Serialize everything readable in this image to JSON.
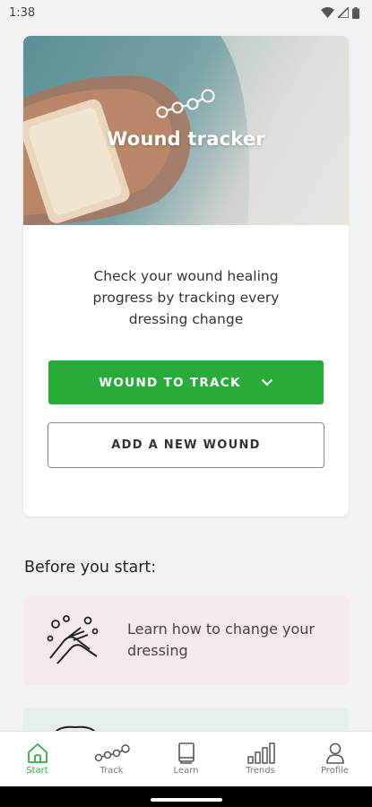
{
  "status_bar": {
    "time": "1:38"
  },
  "hero": {
    "title": "Wound tracker"
  },
  "card": {
    "description": "Check your wound healing progress by tracking every dressing change",
    "primary_button": "WOUND TO TRACK",
    "secondary_button": "ADD A NEW WOUND"
  },
  "before_section": {
    "title": "Before you start:",
    "tips": [
      {
        "label": "Learn how to change your dressing"
      }
    ]
  },
  "bottom_nav": {
    "items": [
      {
        "label": "Start",
        "icon": "home-icon",
        "active": true
      },
      {
        "label": "Track",
        "icon": "track-icon",
        "active": false
      },
      {
        "label": "Learn",
        "icon": "book-icon",
        "active": false
      },
      {
        "label": "Trends",
        "icon": "trends-icon",
        "active": false
      },
      {
        "label": "Profile",
        "icon": "profile-icon",
        "active": false
      }
    ]
  },
  "colors": {
    "accent": "#27ac3a",
    "nav_active": "#2fae43",
    "tip_pink": "#f5e9ec",
    "tip_green": "#e6eeec"
  }
}
